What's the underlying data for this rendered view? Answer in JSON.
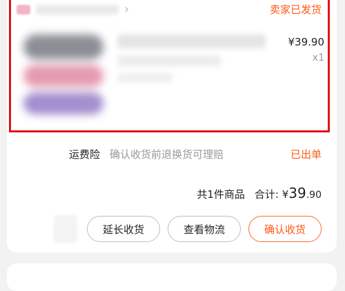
{
  "shop": {
    "status": "卖家已发货"
  },
  "product": {
    "price": "¥39.90",
    "quantity": "x1"
  },
  "insurance": {
    "label": "运费险",
    "description": "确认收货前退换货可理赔",
    "status": "已出单"
  },
  "summary": {
    "count_text": "共1件商品",
    "total_label": "合计:",
    "currency": "¥",
    "total_int": "39",
    "total_dec": ".90"
  },
  "actions": {
    "extend": "延长收货",
    "logistics": "查看物流",
    "confirm": "确认收货"
  },
  "colors": {
    "accent": "#ff5a14",
    "highlight_border": "#e0141a"
  }
}
